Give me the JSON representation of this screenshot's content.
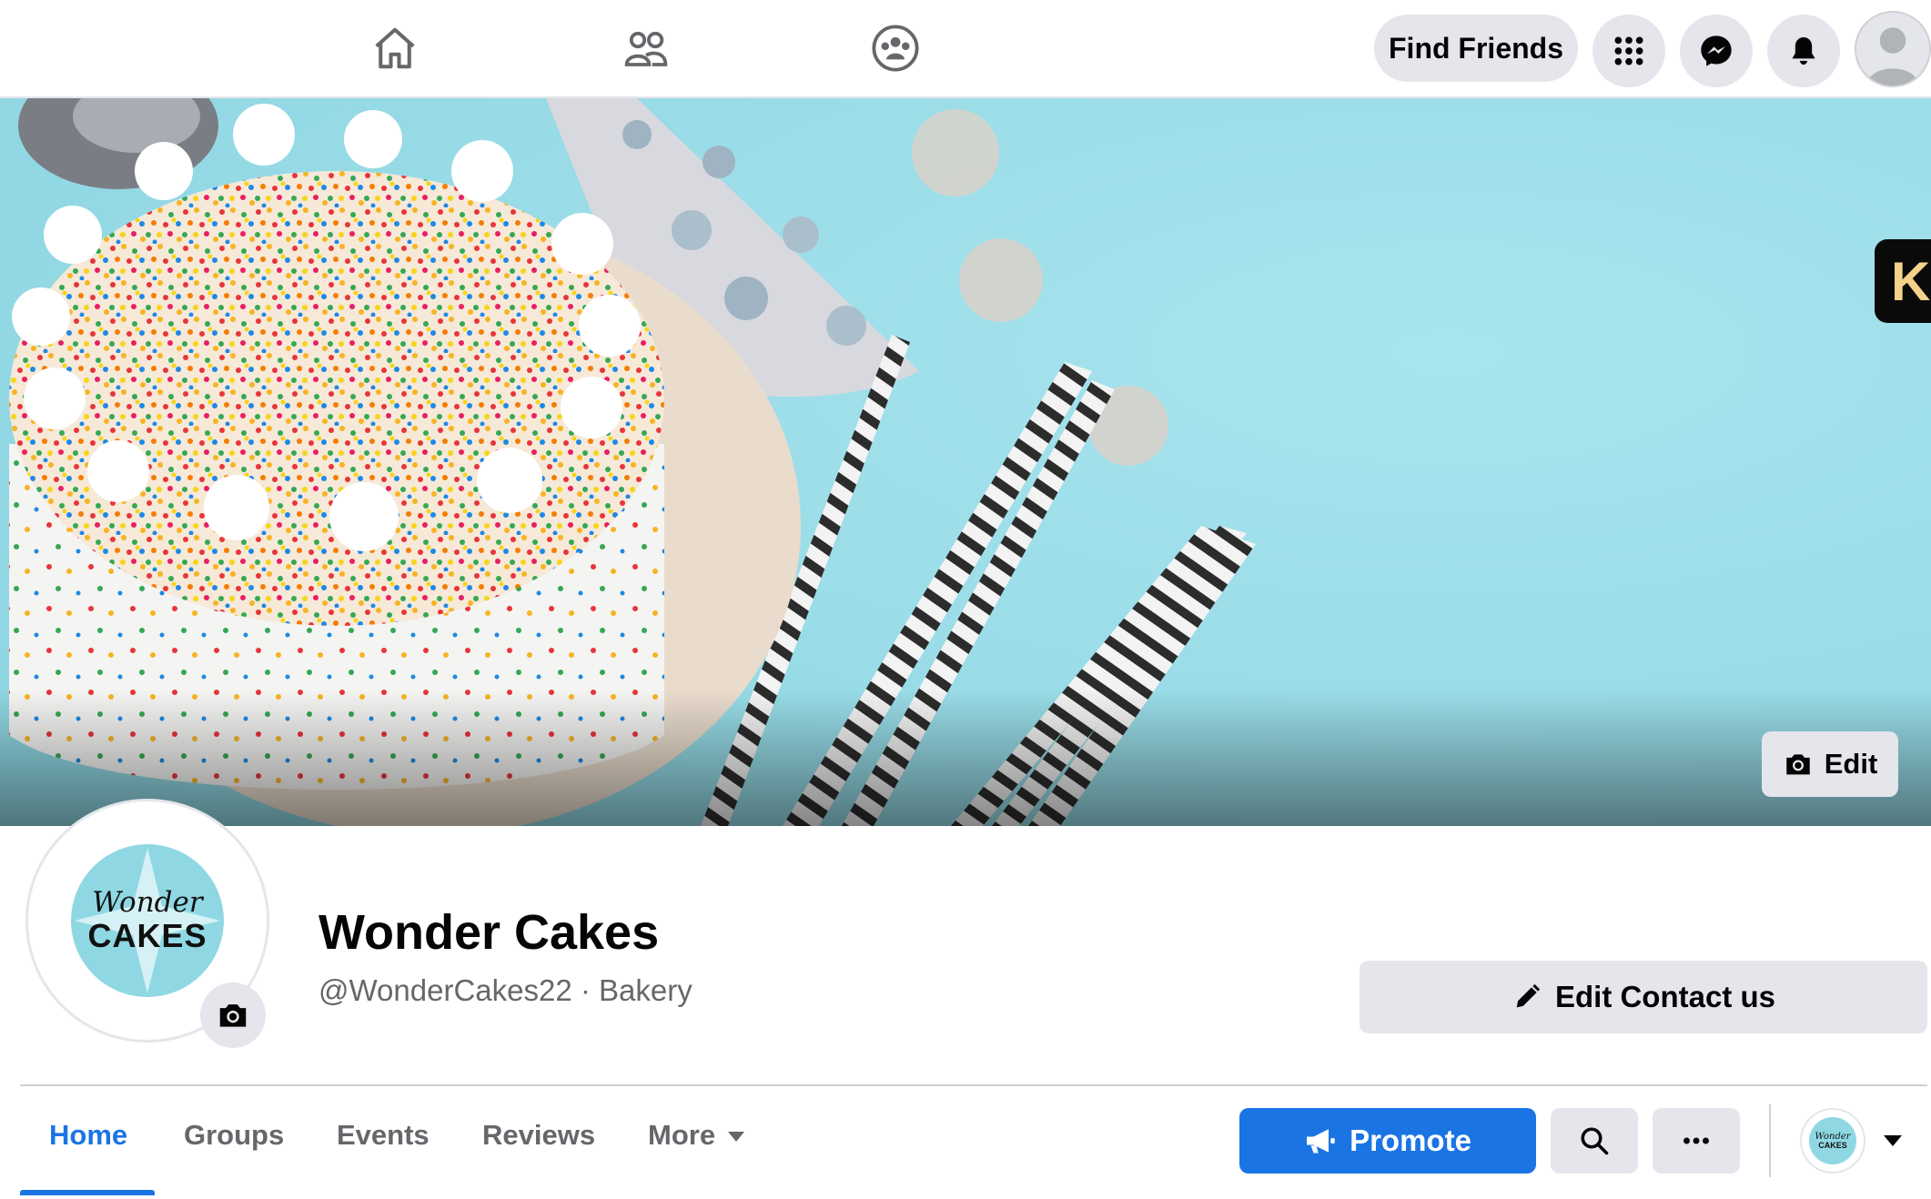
{
  "topbar": {
    "nav": [
      {
        "name": "home-icon"
      },
      {
        "name": "friends-icon"
      },
      {
        "name": "groups-icon"
      }
    ],
    "find_friends_label": "Find Friends",
    "menu_icon": "grid-menu-icon",
    "messenger_icon": "messenger-icon",
    "notifications_icon": "bell-icon",
    "account_icon": "profile-avatar"
  },
  "cover": {
    "edit_label": "Edit",
    "side_badge_letter": "K"
  },
  "profile": {
    "logo_script": "Wonder",
    "logo_caps": "CAKES",
    "page_name": "Wonder Cakes",
    "page_sub": "@WonderCakes22 · Bakery",
    "edit_contact_label": "Edit Contact us"
  },
  "tabs": [
    {
      "label": "Home",
      "active": true
    },
    {
      "label": "Groups",
      "active": false
    },
    {
      "label": "Events",
      "active": false
    },
    {
      "label": "Reviews",
      "active": false
    },
    {
      "label": "More",
      "active": false
    }
  ],
  "actions": {
    "promote_label": "Promote",
    "mini_logo_script": "Wonder",
    "mini_logo_caps": "CAKES"
  },
  "colors": {
    "accent": "#1b74e4",
    "button_gray": "#e4e6eb",
    "cover_bg": "#9adfe9",
    "logo_teal": "#8fd8e3"
  }
}
